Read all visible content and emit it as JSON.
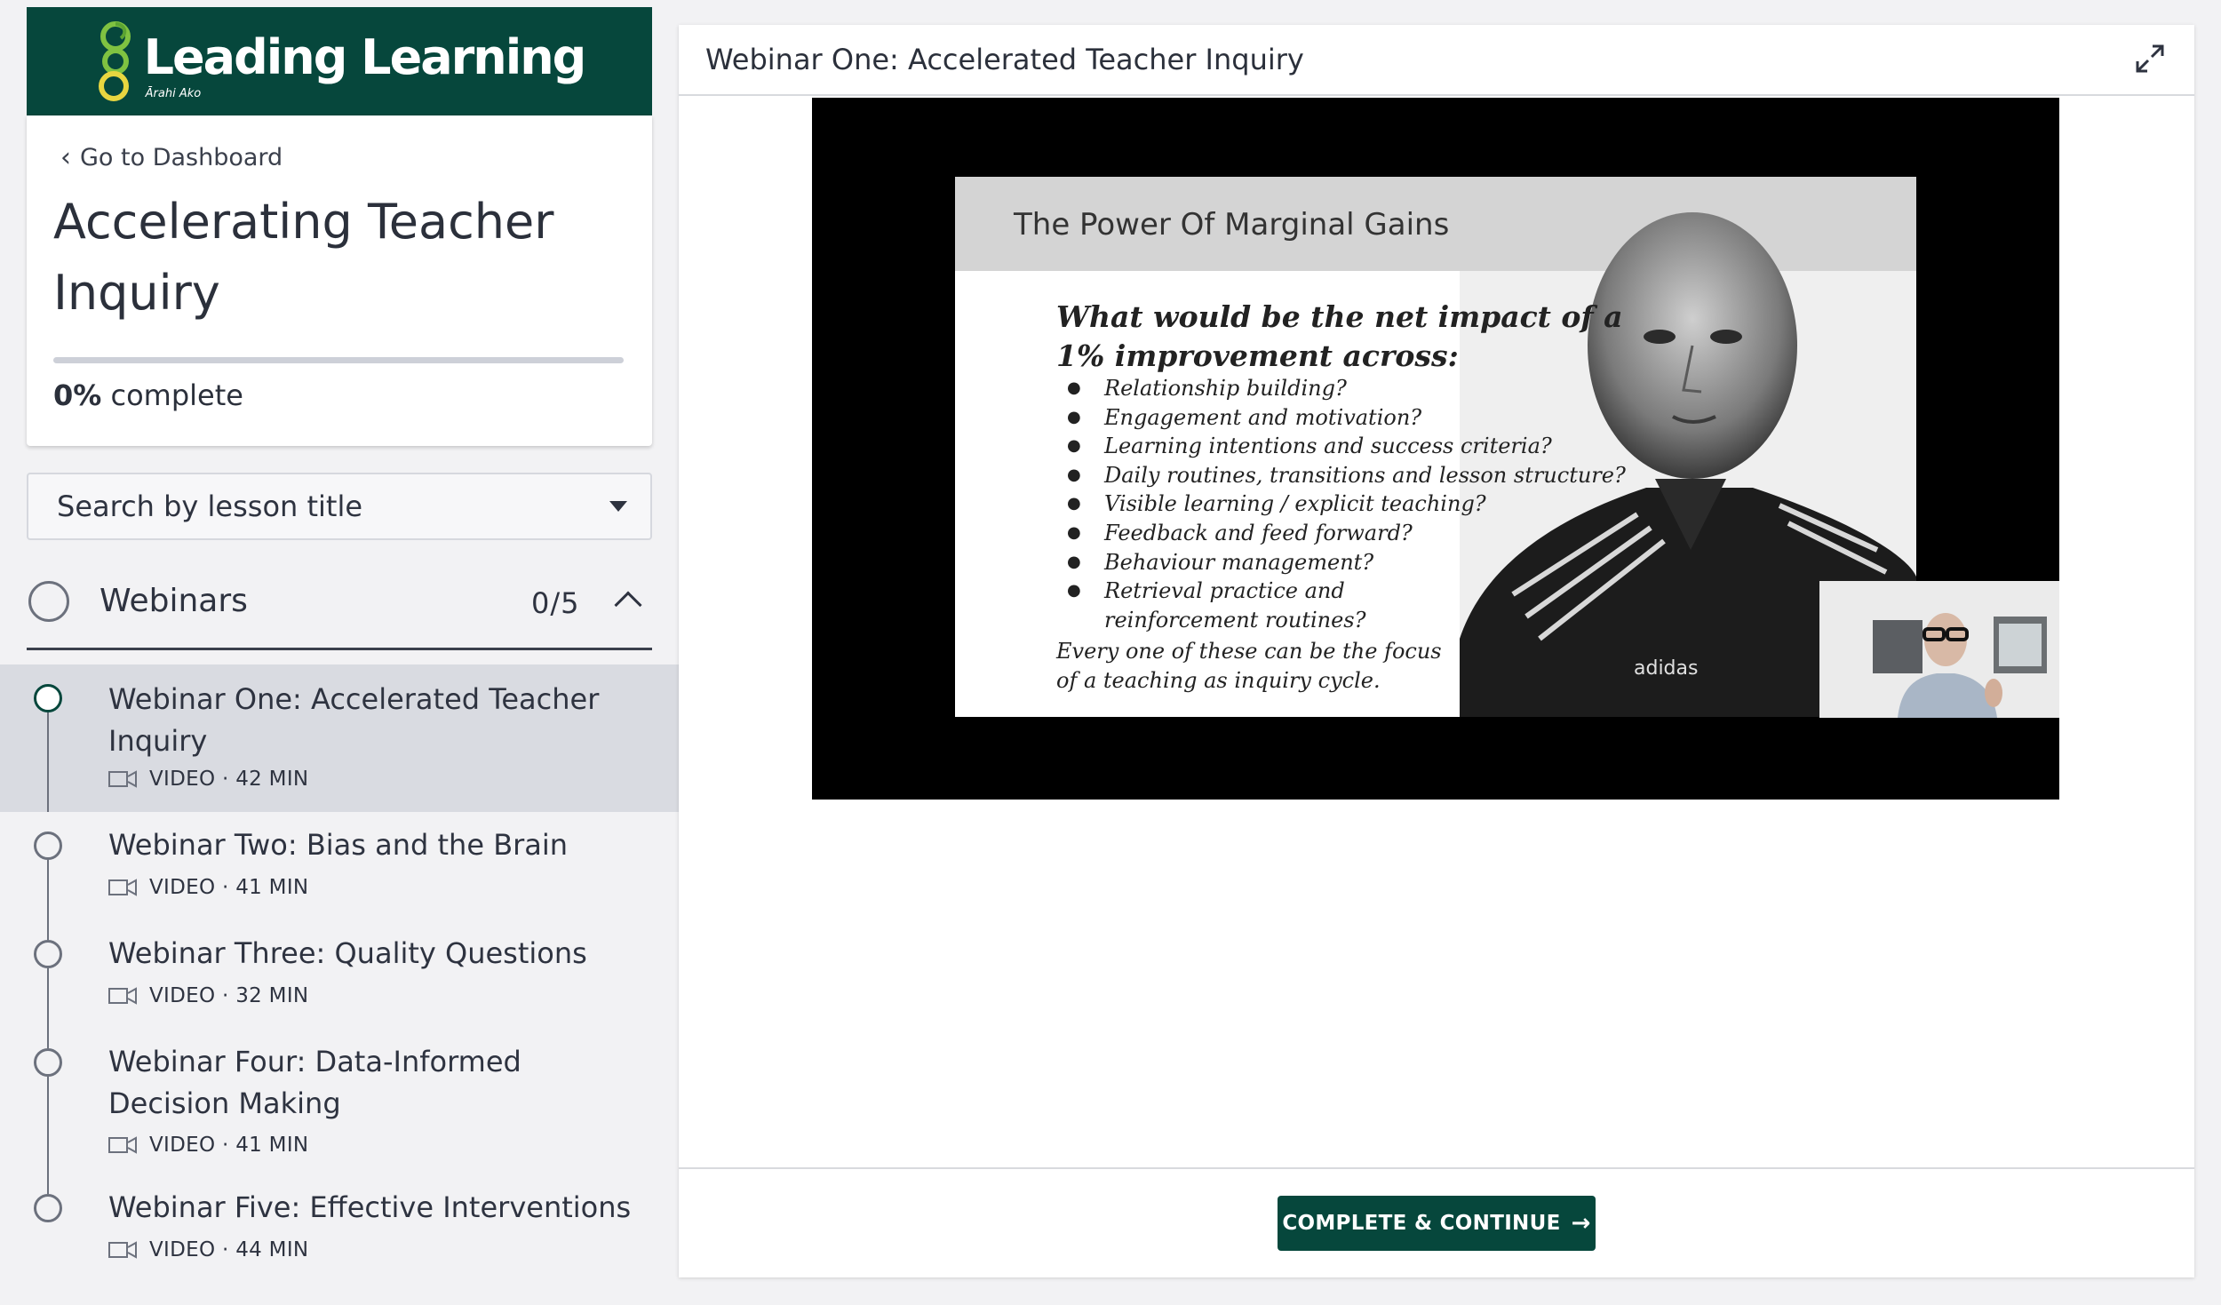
{
  "brand": {
    "name": "Leading Learning",
    "subtitle": "Ārahi Ako",
    "color": "#06473c"
  },
  "sidebar": {
    "back_link": "Go to Dashboard",
    "course_title": "Accelerating Teacher Inquiry",
    "progress_percent": 0,
    "progress_value": "0%",
    "progress_suffix": "complete",
    "search_placeholder": "Search by lesson title",
    "section": {
      "title": "Webinars",
      "count": "0/5"
    },
    "lessons": [
      {
        "title": "Webinar One: Accelerated Teacher Inquiry",
        "meta": "VIDEO · 42 MIN",
        "active": true
      },
      {
        "title": "Webinar Two: Bias and the Brain",
        "meta": "VIDEO · 41 MIN",
        "active": false
      },
      {
        "title": "Webinar Three: Quality Questions",
        "meta": "VIDEO · 32 MIN",
        "active": false
      },
      {
        "title": "Webinar Four: Data-Informed Decision Making",
        "meta": "VIDEO · 41 MIN",
        "active": false
      },
      {
        "title": "Webinar Five: Effective Interventions",
        "meta": "VIDEO · 44 MIN",
        "active": false
      }
    ]
  },
  "main": {
    "lesson_title": "Webinar One: Accelerated Teacher Inquiry",
    "slide": {
      "title": "The Power Of Marginal Gains",
      "question": "What would be the net impact of a 1% improvement across:",
      "bullets": [
        "Relationship building?",
        "Engagement and motivation?",
        "Learning intentions and success criteria?",
        "Daily routines, transitions and lesson structure?",
        "Visible learning / explicit teaching?",
        "Feedback and feed forward?",
        "Behaviour management?",
        "Retrieval practice and",
        "reinforcement routines?"
      ],
      "footer_line1": "Every one of these can be the focus",
      "footer_line2": "of a teaching as inquiry cycle.",
      "jacket_brand": "adidas"
    },
    "cta_label": "COMPLETE & CONTINUE",
    "cta_arrow": "→"
  }
}
